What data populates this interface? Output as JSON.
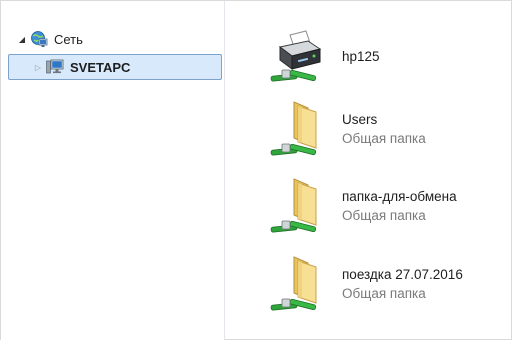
{
  "navigation": {
    "network": {
      "label": "Сеть",
      "icon": "network-globe-icon",
      "expanded": true
    },
    "computer": {
      "label": "SVETAPC",
      "icon": "computer-monitor-icon",
      "expanded": false,
      "selected": true
    }
  },
  "items": [
    {
      "name": "hp125",
      "subtitle": "",
      "icon": "shared-printer-icon"
    },
    {
      "name": "Users",
      "subtitle": "Общая папка",
      "icon": "shared-folder-icon"
    },
    {
      "name": "папка-для-обмена",
      "subtitle": "Общая папка",
      "icon": "shared-folder-icon"
    },
    {
      "name": "поездка 27.07.2016",
      "subtitle": "Общая папка",
      "icon": "shared-folder-icon"
    }
  ],
  "colors": {
    "selection_fill": "#d8e9fb",
    "selection_border": "#7da2ce",
    "folder": "#f2d27a",
    "network_pipe": "#2fa43a"
  }
}
